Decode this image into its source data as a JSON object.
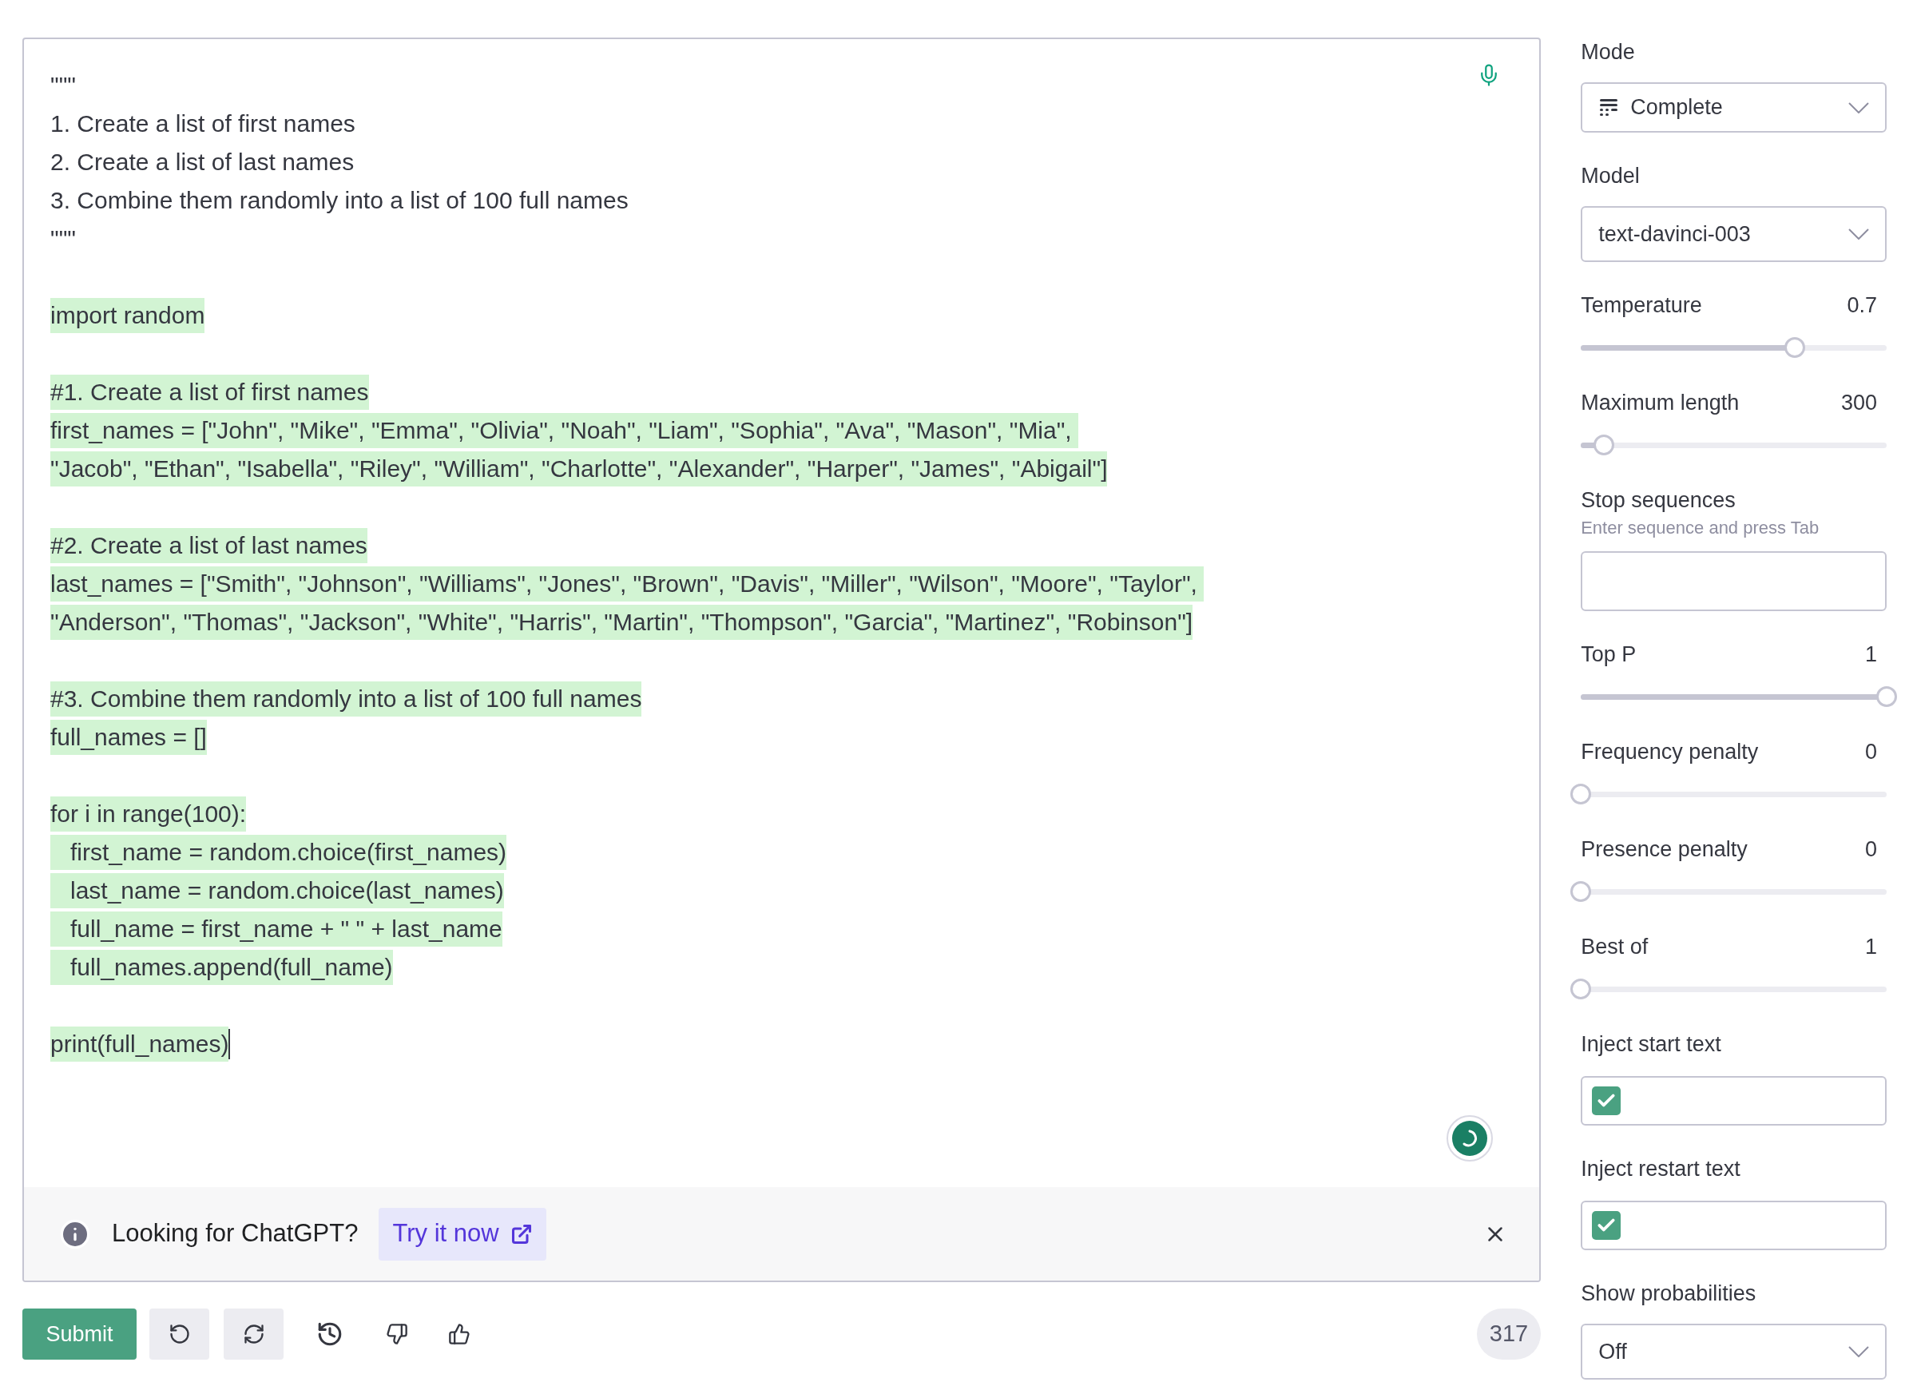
{
  "editor": {
    "lines": [
      {
        "kind": "text",
        "text": "\"\"\"",
        "highlighted": false,
        "cursor": false
      },
      {
        "kind": "text",
        "text": "1. Create a list of first names",
        "highlighted": false,
        "cursor": false
      },
      {
        "kind": "text",
        "text": "2. Create a list of last names",
        "highlighted": false,
        "cursor": false
      },
      {
        "kind": "text",
        "text": "3. Combine them randomly into a list of 100 full names",
        "highlighted": false,
        "cursor": false
      },
      {
        "kind": "text",
        "text": "\"\"\"",
        "highlighted": false,
        "cursor": false
      },
      {
        "kind": "blank"
      },
      {
        "kind": "text",
        "text": "import random",
        "highlighted": true,
        "cursor": false
      },
      {
        "kind": "blank"
      },
      {
        "kind": "text",
        "text": "#1. Create a list of first names",
        "highlighted": true,
        "cursor": false
      },
      {
        "kind": "text",
        "text": "first_names = [\"John\", \"Mike\", \"Emma\", \"Olivia\", \"Noah\", \"Liam\", \"Sophia\", \"Ava\", \"Mason\", \"Mia\", ",
        "highlighted": true,
        "cursor": false
      },
      {
        "kind": "text",
        "text": "\"Jacob\", \"Ethan\", \"Isabella\", \"Riley\", \"William\", \"Charlotte\", \"Alexander\", \"Harper\", \"James\", \"Abigail\"]",
        "highlighted": true,
        "cursor": false
      },
      {
        "kind": "blank"
      },
      {
        "kind": "text",
        "text": "#2. Create a list of last names",
        "highlighted": true,
        "cursor": false
      },
      {
        "kind": "text",
        "text": "last_names = [\"Smith\", \"Johnson\", \"Williams\", \"Jones\", \"Brown\", \"Davis\", \"Miller\", \"Wilson\", \"Moore\", \"Taylor\", ",
        "highlighted": true,
        "cursor": false
      },
      {
        "kind": "text",
        "text": "\"Anderson\", \"Thomas\", \"Jackson\", \"White\", \"Harris\", \"Martin\", \"Thompson\", \"Garcia\", \"Martinez\", \"Robinson\"]",
        "highlighted": true,
        "cursor": false
      },
      {
        "kind": "blank"
      },
      {
        "kind": "text",
        "text": "#3. Combine them randomly into a list of 100 full names",
        "highlighted": true,
        "cursor": false
      },
      {
        "kind": "text",
        "text": "full_names = []",
        "highlighted": true,
        "cursor": false
      },
      {
        "kind": "blank"
      },
      {
        "kind": "text",
        "text": "for i in range(100):",
        "highlighted": true,
        "cursor": false
      },
      {
        "kind": "text",
        "text": "   first_name = random.choice(first_names)",
        "highlighted": true,
        "cursor": false
      },
      {
        "kind": "text",
        "text": "   last_name = random.choice(last_names)",
        "highlighted": true,
        "cursor": false
      },
      {
        "kind": "text",
        "text": "   full_name = first_name + \" \" + last_name",
        "highlighted": true,
        "cursor": false
      },
      {
        "kind": "text",
        "text": "   full_names.append(full_name)",
        "highlighted": true,
        "cursor": false
      },
      {
        "kind": "blank"
      },
      {
        "kind": "text",
        "text": "print(full_names)",
        "highlighted": true,
        "cursor": true
      }
    ]
  },
  "banner": {
    "text": "Looking for ChatGPT?",
    "link": "Try it now"
  },
  "toolbar": {
    "submit": "Submit",
    "token_count": "317"
  },
  "settings": [
    {
      "kind": "mode-select",
      "label": "Mode",
      "value": "Complete"
    },
    {
      "kind": "select",
      "label": "Model",
      "value": "text-davinci-003"
    },
    {
      "kind": "slider",
      "label": "Temperature",
      "value": "0.7",
      "level": 0.7
    },
    {
      "kind": "slider",
      "label": "Maximum length",
      "value": "300",
      "level": 0.075
    },
    {
      "kind": "tags",
      "label": "Stop sequences",
      "hint": "Enter sequence and press Tab"
    },
    {
      "kind": "slider",
      "label": "Top P",
      "value": "1",
      "level": 1
    },
    {
      "kind": "slider",
      "label": "Frequency penalty",
      "value": "0",
      "level": 0
    },
    {
      "kind": "slider",
      "label": "Presence penalty",
      "value": "0",
      "level": 0
    },
    {
      "kind": "slider",
      "label": "Best of",
      "value": "1",
      "level": 0
    },
    {
      "kind": "checkbox",
      "label": "Inject start text",
      "checked": true
    },
    {
      "kind": "checkbox",
      "label": "Inject restart text",
      "checked": true
    },
    {
      "kind": "select",
      "label": "Show probabilities",
      "value": "Off"
    }
  ]
}
